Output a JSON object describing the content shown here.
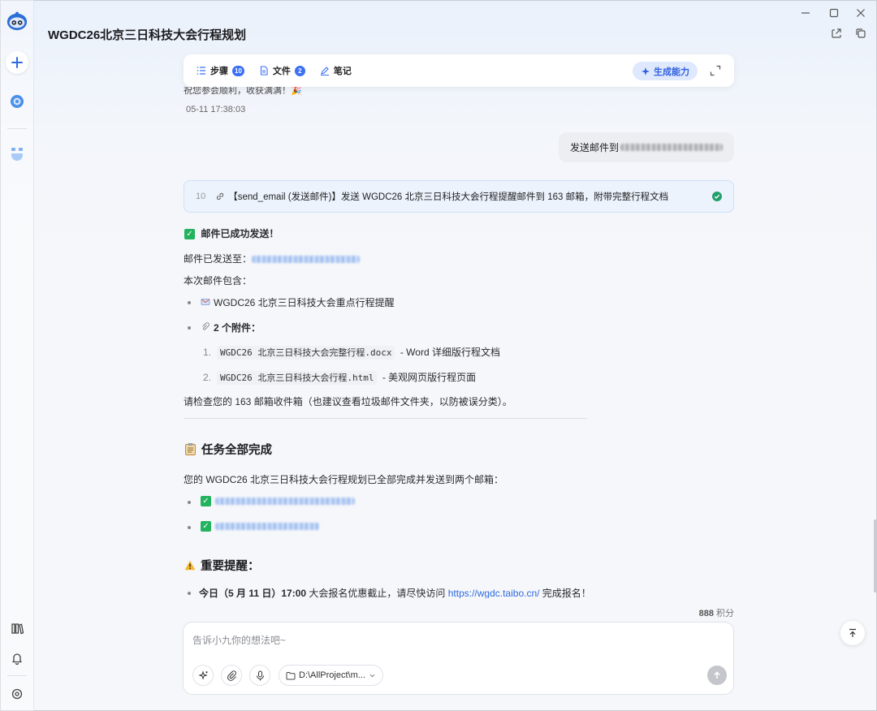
{
  "window": {
    "title": "WGDC26北京三日科技大会行程规划"
  },
  "toolbar": {
    "steps_label": "步骤",
    "steps_count": "10",
    "files_label": "文件",
    "files_count": "2",
    "notes_label": "笔记",
    "generate_label": "生成能力"
  },
  "conversation": {
    "previous_tail": "祝您参会顺利，收获满满！🎉",
    "previous_time": "05-11 17:38:03",
    "user_message_prefix": "发送邮件到",
    "tool_call": {
      "step": "10",
      "text": "【send_email (发送邮件)】发送 WGDC26 北京三日科技大会行程提醒邮件到 163 邮箱，附带完整行程文档"
    },
    "success_title": "邮件已成功发送！",
    "sent_to_label": "邮件已发送至：",
    "includes_label": "本次邮件包含：",
    "item_reminder": "WGDC26 北京三日科技大会重点行程提醒",
    "item_attachments": "2 个附件：",
    "attachments": [
      {
        "num": "1.",
        "file": "WGDC26 北京三日科技大会完整行程.docx",
        "desc": "- Word 详细版行程文档"
      },
      {
        "num": "2.",
        "file": "WGDC26 北京三日科技大会行程.html",
        "desc": "- 美观网页版行程页面"
      }
    ],
    "check_inbox": "请检查您的 163 邮箱收件箱（也建议查看垃圾邮件文件夹，以防被误分类）。",
    "done_title": "任务全部完成",
    "done_desc": "您的 WGDC26 北京三日科技大会行程规划已全部完成并发送到两个邮箱：",
    "important_title": "重要提醒：",
    "reminder_bold": "今日（5 月 11 日）17:00",
    "reminder_text": " 大会报名优惠截止，请尽快访问 ",
    "reminder_link": "https://wgdc.taibo.cn/",
    "reminder_tail": " 完成报名！"
  },
  "points": {
    "value": "888",
    "unit": "积分"
  },
  "input": {
    "placeholder": "告诉小九你的想法吧~",
    "path": "D:\\AllProject\\m..."
  }
}
